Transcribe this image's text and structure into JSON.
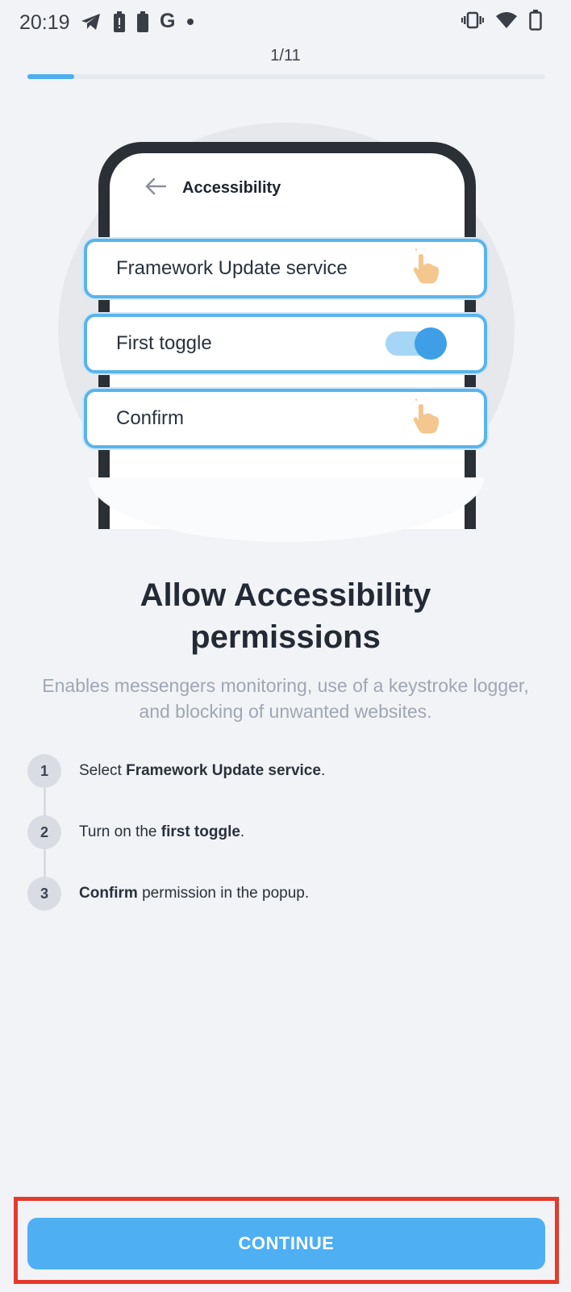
{
  "status_bar": {
    "time": "20:19",
    "left_icons": [
      "telegram-icon",
      "battery-alert-icon",
      "battery-icon",
      "google-icon",
      "dot-icon"
    ],
    "google_letter": "G",
    "right_icons": [
      "vibrate-icon",
      "wifi-icon",
      "battery-outline-icon"
    ]
  },
  "progress": {
    "label": "1/11",
    "fraction": 0.0909
  },
  "illustration": {
    "header_title": "Accessibility",
    "options": [
      {
        "label": "Framework Update service",
        "right": "tap-hand-icon"
      },
      {
        "label": "First toggle",
        "right": "toggle-on-icon"
      },
      {
        "label": "Confirm",
        "right": "tap-hand-icon"
      }
    ]
  },
  "title": {
    "line1": "Allow Accessibility",
    "line2": "permissions"
  },
  "subtitle": "Enables messengers monitoring, use of a keystroke logger, and blocking of unwanted websites.",
  "steps": [
    {
      "number": "1",
      "pre": "Select ",
      "bold": "Framework Update service",
      "post": "."
    },
    {
      "number": "2",
      "pre": "Turn on the ",
      "bold": "first toggle",
      "post": "."
    },
    {
      "number": "3",
      "pre": "",
      "bold": "Confirm",
      "post": " permission in the popup."
    }
  ],
  "continue_label": "CONTINUE",
  "colors": {
    "accent": "#4eaff3",
    "highlight_border": "#e53a2c",
    "background": "#f2f3f6"
  }
}
